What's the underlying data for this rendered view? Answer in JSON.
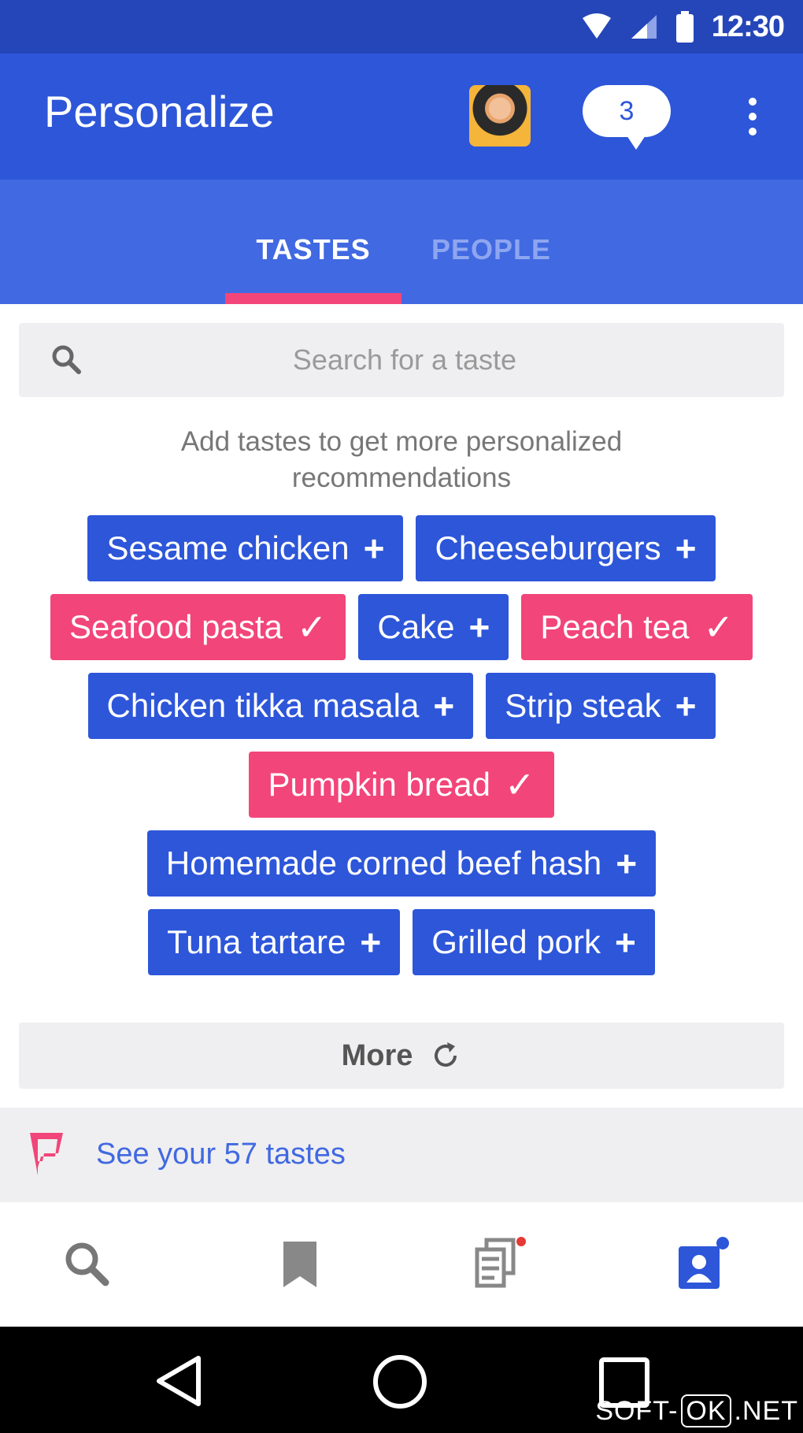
{
  "status_bar": {
    "time": "12:30"
  },
  "app_bar": {
    "title": "Personalize",
    "notifications_count": "3"
  },
  "tabs": [
    {
      "label": "TASTES",
      "active": true
    },
    {
      "label": "PEOPLE",
      "active": false
    }
  ],
  "search": {
    "placeholder": "Search for a taste",
    "value": ""
  },
  "hint": "Add tastes to get more personalized recommendations",
  "chips": [
    [
      {
        "label": "Sesame chicken",
        "selected": false,
        "glyph": "+"
      },
      {
        "label": "Cheeseburgers",
        "selected": false,
        "glyph": "+"
      }
    ],
    [
      {
        "label": "Seafood pasta",
        "selected": true,
        "glyph": "✓"
      },
      {
        "label": "Cake",
        "selected": false,
        "glyph": "+"
      },
      {
        "label": "Peach tea",
        "selected": true,
        "glyph": "✓"
      }
    ],
    [
      {
        "label": "Chicken tikka masala",
        "selected": false,
        "glyph": "+"
      },
      {
        "label": "Strip steak",
        "selected": false,
        "glyph": "+"
      }
    ],
    [
      {
        "label": "Pumpkin bread",
        "selected": true,
        "glyph": "✓"
      }
    ],
    [
      {
        "label": "Homemade corned beef hash",
        "selected": false,
        "glyph": "+"
      }
    ],
    [
      {
        "label": "Tuna tartare",
        "selected": false,
        "glyph": "+"
      },
      {
        "label": "Grilled pork",
        "selected": false,
        "glyph": "+"
      }
    ]
  ],
  "more_button": {
    "label": "More"
  },
  "footer": {
    "link": "See your 57 tastes"
  },
  "bottom_nav": [
    {
      "name": "search",
      "icon": "search-icon"
    },
    {
      "name": "saved",
      "icon": "bookmark-icon"
    },
    {
      "name": "lists",
      "icon": "lists-icon"
    },
    {
      "name": "profile",
      "icon": "profile-icon",
      "active": true
    }
  ],
  "watermark": {
    "left": "SOFT-",
    "boxed": "OK",
    "right": ".NET"
  },
  "colors": {
    "primary": "#2d56d9",
    "tab_bar": "#4169e1",
    "selected_chip": "#f2457a",
    "indicator": "#f2467a"
  }
}
